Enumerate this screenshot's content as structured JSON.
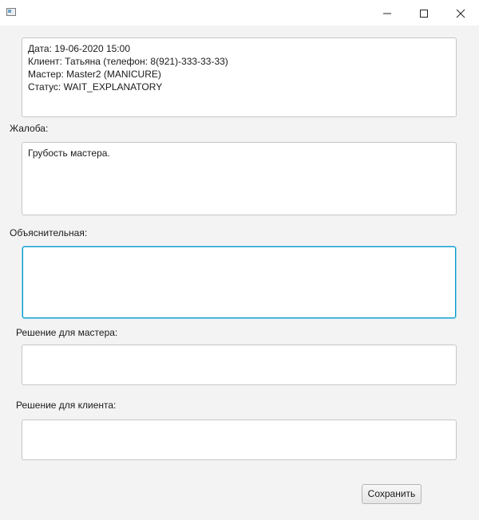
{
  "window": {
    "icon": "app-window-icon",
    "controls": {
      "minimize": "minimize-icon",
      "maximize": "maximize-icon",
      "close": "close-icon"
    }
  },
  "info": {
    "lines": [
      "Дата: 19-06-2020 15:00",
      "Клиент: Татьяна (телефон: 8(921)-333-33-33)",
      "Мастер: Master2 (MANICURE)",
      "Статус: WAIT_EXPLANATORY"
    ]
  },
  "complaint": {
    "label": "Жалоба:",
    "value": "Грубость мастера."
  },
  "explanatory": {
    "label": "Объяснительная:",
    "value": ""
  },
  "master_decision": {
    "label": "Решение для мастера:",
    "value": ""
  },
  "client_decision": {
    "label": "Решение для клиента:",
    "value": ""
  },
  "actions": {
    "save_label": "Сохранить"
  },
  "colors": {
    "focus_border": "#0096c9",
    "background": "#f3f3f3"
  }
}
